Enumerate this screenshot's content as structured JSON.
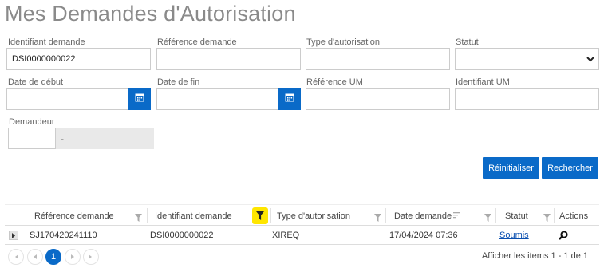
{
  "page": {
    "title": "Mes Demandes d'Autorisation"
  },
  "filters": {
    "identifiant_demande": {
      "label": "Identifiant demande",
      "value": "DSI0000000022"
    },
    "reference_demande": {
      "label": "Référence demande",
      "value": ""
    },
    "type_autorisation": {
      "label": "Type d'autorisation",
      "value": ""
    },
    "statut": {
      "label": "Statut",
      "value": ""
    },
    "date_debut": {
      "label": "Date de début",
      "value": ""
    },
    "date_fin": {
      "label": "Date de fin",
      "value": ""
    },
    "reference_um": {
      "label": "Référence UM",
      "value": ""
    },
    "identifiant_um": {
      "label": "Identifiant UM",
      "value": ""
    },
    "demandeur": {
      "label": "Demandeur",
      "code": "",
      "name": "-"
    }
  },
  "buttons": {
    "reset": "Réinitialiser",
    "search": "Rechercher"
  },
  "grid": {
    "columns": {
      "reference": "Référence demande",
      "identifiant": "Identifiant demande",
      "type": "Type d'autorisation",
      "date": "Date demande",
      "statut": "Statut",
      "actions": "Actions"
    },
    "rows": [
      {
        "reference": "SJ170420241110",
        "identifiant": "DSI0000000022",
        "type": "XIREQ",
        "date": "17/04/2024 07:36",
        "statut": "Soumis"
      }
    ]
  },
  "pager": {
    "current_page": "1",
    "info": "Afficher les items 1 - 1 de 1"
  },
  "colors": {
    "accent": "#0a6ac8",
    "active_filter": "#ffe600"
  }
}
